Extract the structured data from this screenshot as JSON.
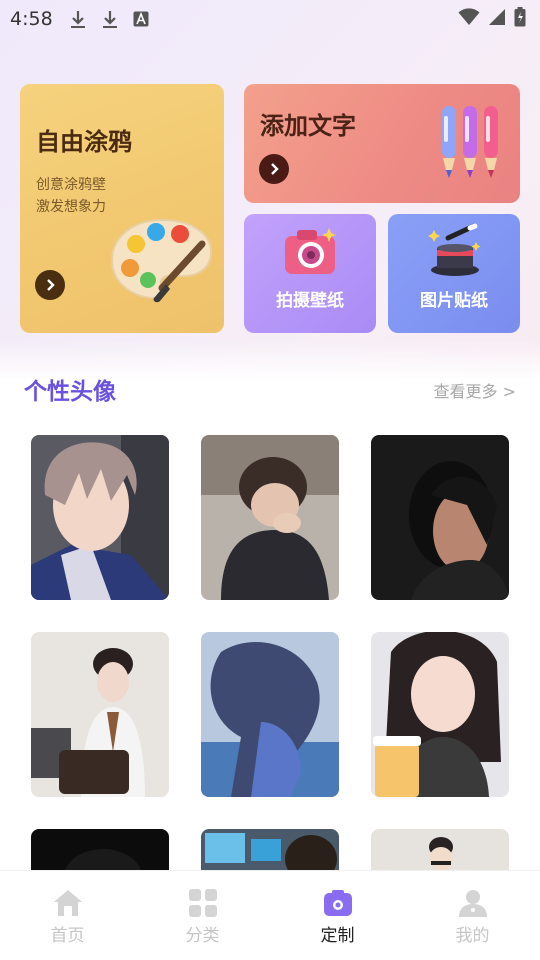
{
  "status_bar": {
    "time": "4:58"
  },
  "feature_cards": {
    "doodle": {
      "title": "自由涂鸦",
      "subtitle_line1": "创意涂鸦壁",
      "subtitle_line2": "激发想象力"
    },
    "add_text": {
      "title": "添加文字"
    },
    "photo_wallpaper": {
      "label": "拍摄壁纸"
    },
    "image_sticker": {
      "label": "图片贴纸"
    }
  },
  "section": {
    "title": "个性头像",
    "more": "查看更多 >"
  },
  "avatars": [
    {
      "description_icon": "anime-boy-avatar"
    },
    {
      "description_icon": "boy-leaning-avatar"
    },
    {
      "description_icon": "shadow-portrait-avatar"
    },
    {
      "description_icon": "schoolgirl-avatar"
    },
    {
      "description_icon": "anime-girl-sea-avatar"
    },
    {
      "description_icon": "girl-drink-avatar"
    },
    {
      "description_icon": "dark-portrait-avatar"
    },
    {
      "description_icon": "computer-desk-avatar"
    },
    {
      "description_icon": "mustache-boy-avatar"
    }
  ],
  "bottom_nav": {
    "home": "首页",
    "category": "分类",
    "custom": "定制",
    "mine": "我的",
    "active": "custom"
  },
  "colors": {
    "accent": "#6a52e0",
    "nav_active": "#222222",
    "nav_inactive": "#c6c6c6"
  }
}
